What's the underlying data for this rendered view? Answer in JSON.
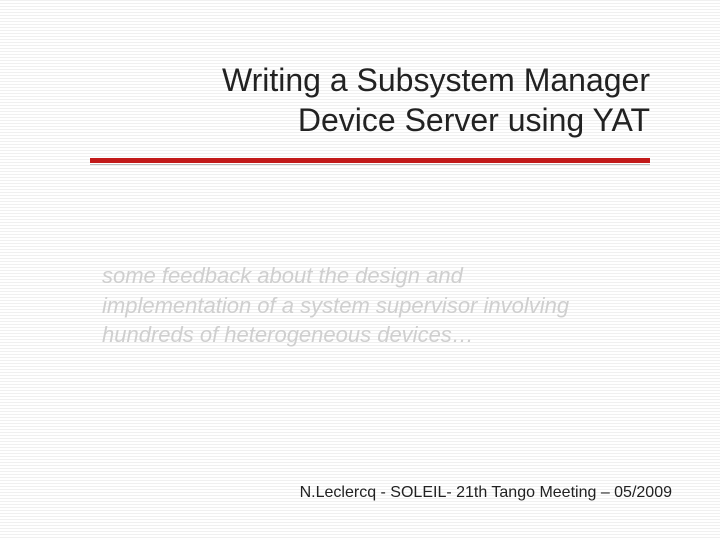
{
  "title_line1": "Writing a Subsystem Manager",
  "title_line2": "Device Server using YAT",
  "subtitle": "some feedback about the design and implementation of a system supervisor involving hundreds of heterogeneous devices…",
  "footer": "N.Leclercq - SOLEIL- 21th Tango Meeting – 05/2009",
  "accent_color": "#c21a1a"
}
